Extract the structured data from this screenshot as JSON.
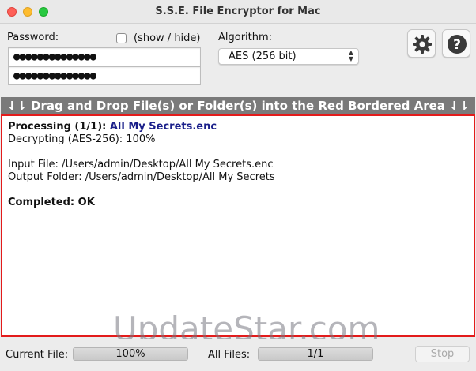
{
  "window": {
    "title": "S.S.E. File Encryptor for Mac"
  },
  "password": {
    "label": "Password:",
    "show_hide_label": "(show / hide)",
    "show_checked": false,
    "field1_value": "●●●●●●●●●●●●●●",
    "field2_value": "●●●●●●●●●●●●●●"
  },
  "algorithm": {
    "label": "Algorithm:",
    "selected": "AES (256 bit)"
  },
  "toolbar": {
    "settings_icon": "gear-icon",
    "help_icon": "question-icon"
  },
  "banner": {
    "text": "⇃⇂ Drag and Drop File(s) or Folder(s) into the Red Bordered Area ⇃⇂"
  },
  "log": {
    "processing_label": "Processing (1/1): ",
    "processing_file": "All My Secrets.enc",
    "decrypting": "Decrypting (AES-256): 100%",
    "input_file": "Input File: /Users/admin/Desktop/All My Secrets.enc",
    "output_folder": "Output Folder: /Users/admin/Desktop/All My Secrets",
    "completed": "Completed: OK"
  },
  "watermark": {
    "text": "UpdateStar.com"
  },
  "status": {
    "current_file_label": "Current File:",
    "current_file_progress_text": "100%",
    "current_file_progress": 1.0,
    "all_files_label": "All Files:",
    "all_files_progress_text": "1/1",
    "all_files_progress": 1.0,
    "stop_label": "Stop"
  },
  "colors": {
    "drop_border": "#e31b1b",
    "banner_bg": "#7a7a7a",
    "filename": "#1a1f8a"
  }
}
